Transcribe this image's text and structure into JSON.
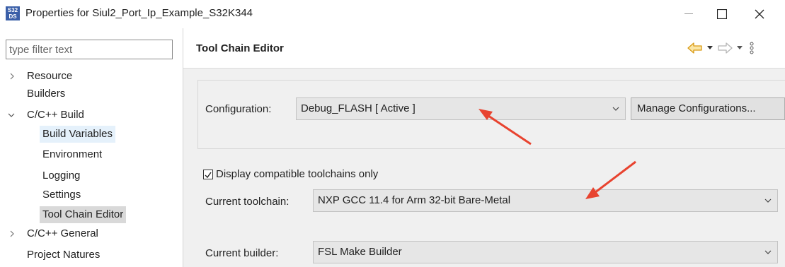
{
  "window": {
    "title": "Properties for Siul2_Port_Ip_Example_S32K344",
    "app_icon_text_top": "S32",
    "app_icon_text_bottom": "DS",
    "minimize_glyph": "—",
    "maximize_glyph": "☐",
    "close_glyph": "✕"
  },
  "sidebar": {
    "filter_placeholder": "type filter text",
    "items": [
      {
        "label": "Resource",
        "twisty": "›"
      },
      {
        "label": "Builders"
      },
      {
        "label": "C/C++ Build",
        "twisty": "⌄"
      },
      {
        "label": "Build Variables"
      },
      {
        "label": "Environment"
      },
      {
        "label": "Logging"
      },
      {
        "label": "Settings"
      },
      {
        "label": "Tool Chain Editor"
      },
      {
        "label": "C/C++ General",
        "twisty": "›"
      },
      {
        "label": "Project Natures"
      }
    ]
  },
  "page": {
    "title": "Tool Chain Editor",
    "nav_icons": [
      "back-arrow-icon",
      "dropdown-icon",
      "forward-arrow-icon",
      "dropdown-icon",
      "view-menu-icon"
    ]
  },
  "configuration": {
    "label": "Configuration:",
    "value": "Debug_FLASH  [ Active ]",
    "manage_button": "Manage Configurations..."
  },
  "toolchain": {
    "display_compatible_label": "Display compatible toolchains only",
    "display_compatible_checked": true,
    "current_toolchain_label": "Current toolchain:",
    "current_toolchain_value": "NXP GCC 11.4 for Arm 32-bit Bare-Metal",
    "current_builder_label": "Current builder:",
    "current_builder_value": "FSL Make Builder"
  },
  "colors": {
    "annotation_arrow": "#e8432f",
    "back_arrow": "#e8a317",
    "selected_item_bg": "#d9d9d9",
    "hover_item_bg": "#e5f1fb"
  }
}
